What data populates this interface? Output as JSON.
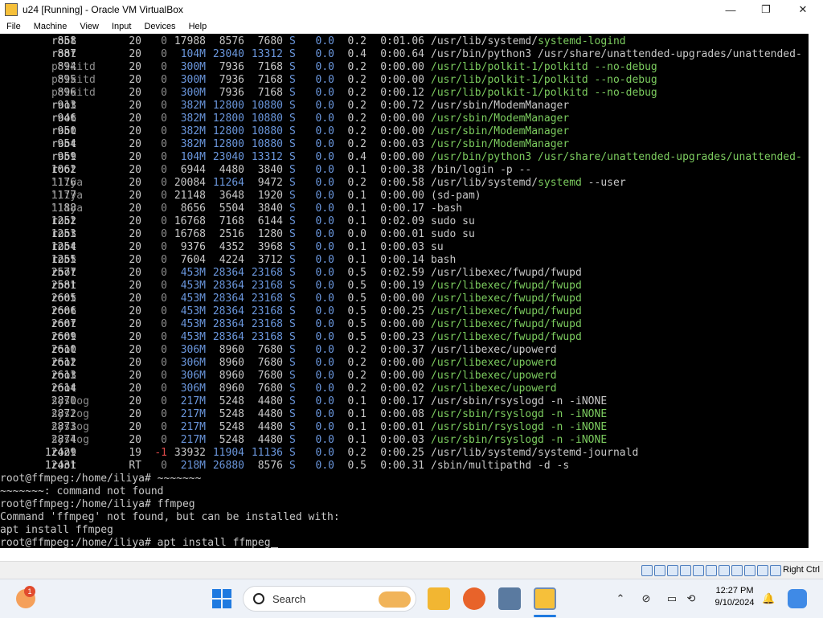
{
  "window": {
    "title": "u24 [Running] - Oracle VM VirtualBox",
    "minimize_glyph": "—",
    "maximize_glyph": "❐",
    "close_glyph": "✕"
  },
  "menu": {
    "items": [
      "File",
      "Machine",
      "View",
      "Input",
      "Devices",
      "Help"
    ]
  },
  "terminal": {
    "processes": [
      {
        "pid": "858",
        "user": "root",
        "pr": "20",
        "ni": "0",
        "virt": "17988",
        "res": "8576",
        "shr": "7680",
        "s": "S",
        "cpu": "0.0",
        "mem": "0.2",
        "time": "0:01.06",
        "cmd_prefix": "/usr/lib/systemd/",
        "cmd_hl": "systemd-logind",
        "cmd_rest": "",
        "color": "plain"
      },
      {
        "pid": "887",
        "user": "root",
        "pr": "20",
        "ni": "0",
        "virt": "104M",
        "res": "23040",
        "shr": "13312",
        "s": "S",
        "cpu": "0.0",
        "mem": "0.4",
        "time": "0:00.64",
        "cmd_prefix": "/usr/bin/python3 /usr/share/unattended-upgrades/unattended-",
        "cmd_hl": "",
        "cmd_rest": "",
        "color": "plain"
      },
      {
        "pid": "894",
        "user": "polkitd",
        "pr": "20",
        "ni": "0",
        "virt": "300M",
        "res": "7936",
        "shr": "7168",
        "s": "S",
        "cpu": "0.0",
        "mem": "0.2",
        "time": "0:00.00",
        "cmd_prefix": "/usr/lib/polkit-1/polkitd --no-debug",
        "cmd_hl": "",
        "cmd_rest": "",
        "color": "green"
      },
      {
        "pid": "895",
        "user": "polkitd",
        "pr": "20",
        "ni": "0",
        "virt": "300M",
        "res": "7936",
        "shr": "7168",
        "s": "S",
        "cpu": "0.0",
        "mem": "0.2",
        "time": "0:00.00",
        "cmd_prefix": "/usr/lib/polkit-1/polkitd --no-debug",
        "cmd_hl": "",
        "cmd_rest": "",
        "color": "green"
      },
      {
        "pid": "896",
        "user": "polkitd",
        "pr": "20",
        "ni": "0",
        "virt": "300M",
        "res": "7936",
        "shr": "7168",
        "s": "S",
        "cpu": "0.0",
        "mem": "0.2",
        "time": "0:00.12",
        "cmd_prefix": "/usr/lib/polkit-1/polkitd --no-debug",
        "cmd_hl": "",
        "cmd_rest": "",
        "color": "green"
      },
      {
        "pid": "913",
        "user": "root",
        "pr": "20",
        "ni": "0",
        "virt": "382M",
        "res": "12800",
        "shr": "10880",
        "s": "S",
        "cpu": "0.0",
        "mem": "0.2",
        "time": "0:00.72",
        "cmd_prefix": "/usr/sbin/ModemManager",
        "cmd_hl": "",
        "cmd_rest": "",
        "color": "plain"
      },
      {
        "pid": "946",
        "user": "root",
        "pr": "20",
        "ni": "0",
        "virt": "382M",
        "res": "12800",
        "shr": "10880",
        "s": "S",
        "cpu": "0.0",
        "mem": "0.2",
        "time": "0:00.00",
        "cmd_prefix": "/usr/sbin/ModemManager",
        "cmd_hl": "",
        "cmd_rest": "",
        "color": "green"
      },
      {
        "pid": "950",
        "user": "root",
        "pr": "20",
        "ni": "0",
        "virt": "382M",
        "res": "12800",
        "shr": "10880",
        "s": "S",
        "cpu": "0.0",
        "mem": "0.2",
        "time": "0:00.00",
        "cmd_prefix": "/usr/sbin/ModemManager",
        "cmd_hl": "",
        "cmd_rest": "",
        "color": "green"
      },
      {
        "pid": "954",
        "user": "root",
        "pr": "20",
        "ni": "0",
        "virt": "382M",
        "res": "12800",
        "shr": "10880",
        "s": "S",
        "cpu": "0.0",
        "mem": "0.2",
        "time": "0:00.03",
        "cmd_prefix": "/usr/sbin/ModemManager",
        "cmd_hl": "",
        "cmd_rest": "",
        "color": "green"
      },
      {
        "pid": "959",
        "user": "root",
        "pr": "20",
        "ni": "0",
        "virt": "104M",
        "res": "23040",
        "shr": "13312",
        "s": "S",
        "cpu": "0.0",
        "mem": "0.4",
        "time": "0:00.00",
        "cmd_prefix": "/usr/bin/python3 /usr/share/unattended-upgrades/unattended-",
        "cmd_hl": "",
        "cmd_rest": "",
        "color": "green"
      },
      {
        "pid": "1062",
        "user": "root",
        "pr": "20",
        "ni": "0",
        "virt": "6944",
        "res": "4480",
        "shr": "3840",
        "s": "S",
        "cpu": "0.0",
        "mem": "0.1",
        "time": "0:00.38",
        "cmd_prefix": "/bin/login -p --",
        "cmd_hl": "",
        "cmd_rest": "",
        "color": "plain"
      },
      {
        "pid": "1176",
        "user": "iliya",
        "pr": "20",
        "ni": "0",
        "virt": "20084",
        "res": "11264",
        "shr": "9472",
        "s": "S",
        "cpu": "0.0",
        "mem": "0.2",
        "time": "0:00.58",
        "cmd_prefix": "/usr/lib/systemd/",
        "cmd_hl": "systemd",
        "cmd_rest": " --user",
        "color": "plain"
      },
      {
        "pid": "1177",
        "user": "iliya",
        "pr": "20",
        "ni": "0",
        "virt": "21148",
        "res": "3648",
        "shr": "1920",
        "s": "S",
        "cpu": "0.0",
        "mem": "0.1",
        "time": "0:00.00",
        "cmd_prefix": "(sd-pam)",
        "cmd_hl": "",
        "cmd_rest": "",
        "color": "plain"
      },
      {
        "pid": "1188",
        "user": "iliya",
        "pr": "20",
        "ni": "0",
        "virt": "8656",
        "res": "5504",
        "shr": "3840",
        "s": "S",
        "cpu": "0.0",
        "mem": "0.1",
        "time": "0:00.17",
        "cmd_prefix": "-bash",
        "cmd_hl": "",
        "cmd_rest": "",
        "color": "plain"
      },
      {
        "pid": "1252",
        "user": "root",
        "pr": "20",
        "ni": "0",
        "virt": "16768",
        "res": "7168",
        "shr": "6144",
        "s": "S",
        "cpu": "0.0",
        "mem": "0.1",
        "time": "0:02.09",
        "cmd_prefix": "sudo su",
        "cmd_hl": "",
        "cmd_rest": "",
        "color": "plain"
      },
      {
        "pid": "1253",
        "user": "root",
        "pr": "20",
        "ni": "0",
        "virt": "16768",
        "res": "2516",
        "shr": "1280",
        "s": "S",
        "cpu": "0.0",
        "mem": "0.0",
        "time": "0:00.01",
        "cmd_prefix": "sudo su",
        "cmd_hl": "",
        "cmd_rest": "",
        "color": "plain"
      },
      {
        "pid": "1254",
        "user": "root",
        "pr": "20",
        "ni": "0",
        "virt": "9376",
        "res": "4352",
        "shr": "3968",
        "s": "S",
        "cpu": "0.0",
        "mem": "0.1",
        "time": "0:00.03",
        "cmd_prefix": "su",
        "cmd_hl": "",
        "cmd_rest": "",
        "color": "plain"
      },
      {
        "pid": "1255",
        "user": "root",
        "pr": "20",
        "ni": "0",
        "virt": "7604",
        "res": "4224",
        "shr": "3712",
        "s": "S",
        "cpu": "0.0",
        "mem": "0.1",
        "time": "0:00.14",
        "cmd_prefix": "bash",
        "cmd_hl": "",
        "cmd_rest": "",
        "color": "plain"
      },
      {
        "pid": "2577",
        "user": "root",
        "pr": "20",
        "ni": "0",
        "virt": "453M",
        "res": "28364",
        "shr": "23168",
        "s": "S",
        "cpu": "0.0",
        "mem": "0.5",
        "time": "0:02.59",
        "cmd_prefix": "/usr/libexec/fwupd/fwupd",
        "cmd_hl": "",
        "cmd_rest": "",
        "color": "plain"
      },
      {
        "pid": "2581",
        "user": "root",
        "pr": "20",
        "ni": "0",
        "virt": "453M",
        "res": "28364",
        "shr": "23168",
        "s": "S",
        "cpu": "0.0",
        "mem": "0.5",
        "time": "0:00.19",
        "cmd_prefix": "/usr/libexec/fwupd/fwupd",
        "cmd_hl": "",
        "cmd_rest": "",
        "color": "green"
      },
      {
        "pid": "2605",
        "user": "root",
        "pr": "20",
        "ni": "0",
        "virt": "453M",
        "res": "28364",
        "shr": "23168",
        "s": "S",
        "cpu": "0.0",
        "mem": "0.5",
        "time": "0:00.00",
        "cmd_prefix": "/usr/libexec/fwupd/fwupd",
        "cmd_hl": "",
        "cmd_rest": "",
        "color": "green"
      },
      {
        "pid": "2606",
        "user": "root",
        "pr": "20",
        "ni": "0",
        "virt": "453M",
        "res": "28364",
        "shr": "23168",
        "s": "S",
        "cpu": "0.0",
        "mem": "0.5",
        "time": "0:00.25",
        "cmd_prefix": "/usr/libexec/fwupd/fwupd",
        "cmd_hl": "",
        "cmd_rest": "",
        "color": "green"
      },
      {
        "pid": "2607",
        "user": "root",
        "pr": "20",
        "ni": "0",
        "virt": "453M",
        "res": "28364",
        "shr": "23168",
        "s": "S",
        "cpu": "0.0",
        "mem": "0.5",
        "time": "0:00.00",
        "cmd_prefix": "/usr/libexec/fwupd/fwupd",
        "cmd_hl": "",
        "cmd_rest": "",
        "color": "green"
      },
      {
        "pid": "2609",
        "user": "root",
        "pr": "20",
        "ni": "0",
        "virt": "453M",
        "res": "28364",
        "shr": "23168",
        "s": "S",
        "cpu": "0.0",
        "mem": "0.5",
        "time": "0:00.23",
        "cmd_prefix": "/usr/libexec/fwupd/fwupd",
        "cmd_hl": "",
        "cmd_rest": "",
        "color": "green"
      },
      {
        "pid": "2610",
        "user": "root",
        "pr": "20",
        "ni": "0",
        "virt": "306M",
        "res": "8960",
        "shr": "7680",
        "s": "S",
        "cpu": "0.0",
        "mem": "0.2",
        "time": "0:00.37",
        "cmd_prefix": "/usr/libexec/upowerd",
        "cmd_hl": "",
        "cmd_rest": "",
        "color": "plain"
      },
      {
        "pid": "2612",
        "user": "root",
        "pr": "20",
        "ni": "0",
        "virt": "306M",
        "res": "8960",
        "shr": "7680",
        "s": "S",
        "cpu": "0.0",
        "mem": "0.2",
        "time": "0:00.00",
        "cmd_prefix": "/usr/libexec/upowerd",
        "cmd_hl": "",
        "cmd_rest": "",
        "color": "green"
      },
      {
        "pid": "2613",
        "user": "root",
        "pr": "20",
        "ni": "0",
        "virt": "306M",
        "res": "8960",
        "shr": "7680",
        "s": "S",
        "cpu": "0.0",
        "mem": "0.2",
        "time": "0:00.00",
        "cmd_prefix": "/usr/libexec/upowerd",
        "cmd_hl": "",
        "cmd_rest": "",
        "color": "green"
      },
      {
        "pid": "2614",
        "user": "root",
        "pr": "20",
        "ni": "0",
        "virt": "306M",
        "res": "8960",
        "shr": "7680",
        "s": "S",
        "cpu": "0.0",
        "mem": "0.2",
        "time": "0:00.02",
        "cmd_prefix": "/usr/libexec/upowerd",
        "cmd_hl": "",
        "cmd_rest": "",
        "color": "green"
      },
      {
        "pid": "2870",
        "user": "syslog",
        "pr": "20",
        "ni": "0",
        "virt": "217M",
        "res": "5248",
        "shr": "4480",
        "s": "S",
        "cpu": "0.0",
        "mem": "0.1",
        "time": "0:00.17",
        "cmd_prefix": "/usr/sbin/rsyslogd -n -iNONE",
        "cmd_hl": "",
        "cmd_rest": "",
        "color": "plain"
      },
      {
        "pid": "2872",
        "user": "syslog",
        "pr": "20",
        "ni": "0",
        "virt": "217M",
        "res": "5248",
        "shr": "4480",
        "s": "S",
        "cpu": "0.0",
        "mem": "0.1",
        "time": "0:00.08",
        "cmd_prefix": "/usr/sbin/rsyslogd -n -iNONE",
        "cmd_hl": "",
        "cmd_rest": "",
        "color": "green"
      },
      {
        "pid": "2873",
        "user": "syslog",
        "pr": "20",
        "ni": "0",
        "virt": "217M",
        "res": "5248",
        "shr": "4480",
        "s": "S",
        "cpu": "0.0",
        "mem": "0.1",
        "time": "0:00.01",
        "cmd_prefix": "/usr/sbin/rsyslogd -n -iNONE",
        "cmd_hl": "",
        "cmd_rest": "",
        "color": "green"
      },
      {
        "pid": "2874",
        "user": "syslog",
        "pr": "20",
        "ni": "0",
        "virt": "217M",
        "res": "5248",
        "shr": "4480",
        "s": "S",
        "cpu": "0.0",
        "mem": "0.1",
        "time": "0:00.03",
        "cmd_prefix": "/usr/sbin/rsyslogd -n -iNONE",
        "cmd_hl": "",
        "cmd_rest": "",
        "color": "green"
      },
      {
        "pid": "12429",
        "user": "root",
        "pr": "19",
        "ni": "-1",
        "virt": "33932",
        "res": "11904",
        "shr": "11136",
        "s": "S",
        "cpu": "0.0",
        "mem": "0.2",
        "time": "0:00.25",
        "cmd_prefix": "/usr/lib/systemd/systemd-journald",
        "cmd_hl": "",
        "cmd_rest": "",
        "color": "plain"
      },
      {
        "pid": "12431",
        "user": "root",
        "pr": "RT",
        "ni": "0",
        "virt": "218M",
        "res": "26880",
        "shr": "8576",
        "s": "S",
        "cpu": "0.0",
        "mem": "0.5",
        "time": "0:00.31",
        "cmd_prefix": "/sbin/multipathd -d -s",
        "cmd_hl": "",
        "cmd_rest": "",
        "color": "plain"
      }
    ],
    "shell_lines": [
      "root@ffmpeg:/home/iliya# ~~~~~~~",
      "~~~~~~~: command not found",
      "root@ffmpeg:/home/iliya# ffmpeg",
      "Command 'ffmpeg' not found, but can be installed with:",
      "apt install ffmpeg"
    ],
    "prompt": "root@ffmpeg:/home/iliya# ",
    "current_command": "apt install ffmpeg"
  },
  "statusbar": {
    "host_key": "Right Ctrl"
  },
  "taskbar": {
    "notification_count": "1",
    "search_placeholder": "Search",
    "time": "12:27 PM",
    "date": "9/10/2024"
  },
  "colors": {
    "terminal_bg": "#000000",
    "terminal_text": "#c8c8c8",
    "blue": "#6a96dc",
    "green": "#7ccc5f",
    "red": "#e04a4a"
  }
}
